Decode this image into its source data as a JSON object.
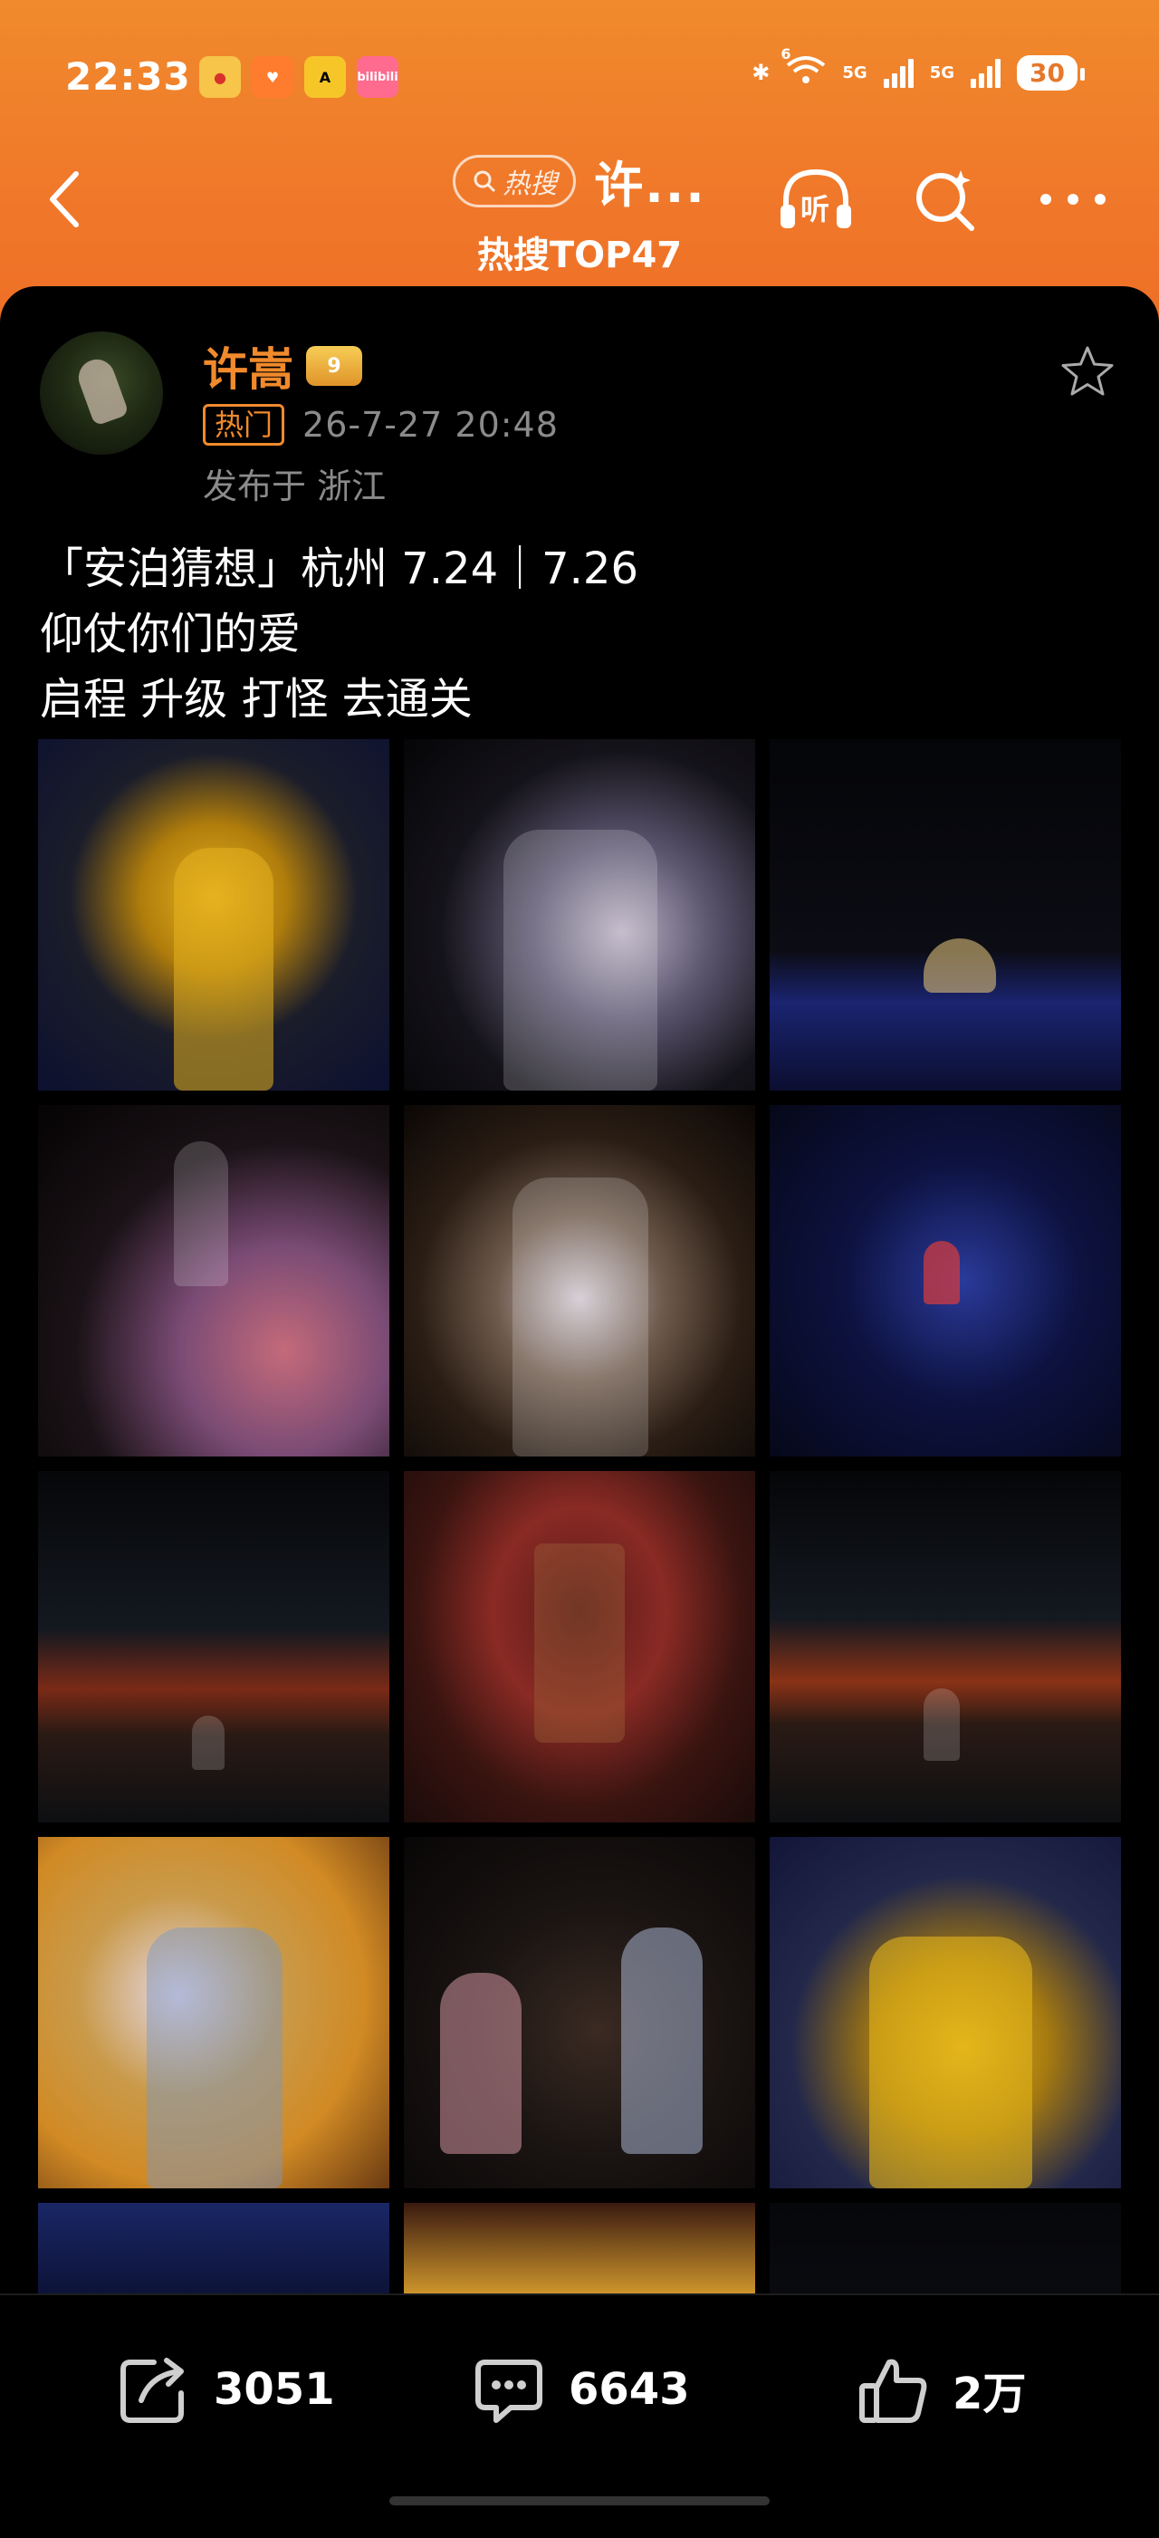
{
  "status_bar": {
    "time": "22:33",
    "app_icons": [
      "weibo-icon",
      "heart-app-icon",
      "a-app-icon",
      "bilibili-icon"
    ],
    "bilibili_label": "bilibili",
    "network_label_1": "5G",
    "network_label_2": "5G",
    "wifi_sup": "6",
    "battery": "30"
  },
  "nav": {
    "hot_pill": "热搜",
    "title": "许...",
    "subtitle": "热搜TOP47",
    "listen_label": "听"
  },
  "post": {
    "username": "许嵩",
    "vip_label": "9",
    "hot_tag": "热门",
    "time": "26-7-27 20:48",
    "location": "发布于 浙江",
    "lines": [
      "「安泊猜想」杭州 7.24｜7.26",
      "仰仗你们的爱",
      "启程 升级 打怪 去通关"
    ]
  },
  "actions": {
    "share_count": "3051",
    "comment_count": "6643",
    "like_count": "2万"
  },
  "colors": {
    "header_orange": "#f08a2c",
    "accent": "#f08a2c",
    "background": "#000000",
    "muted_text": "#8b8b8b"
  }
}
